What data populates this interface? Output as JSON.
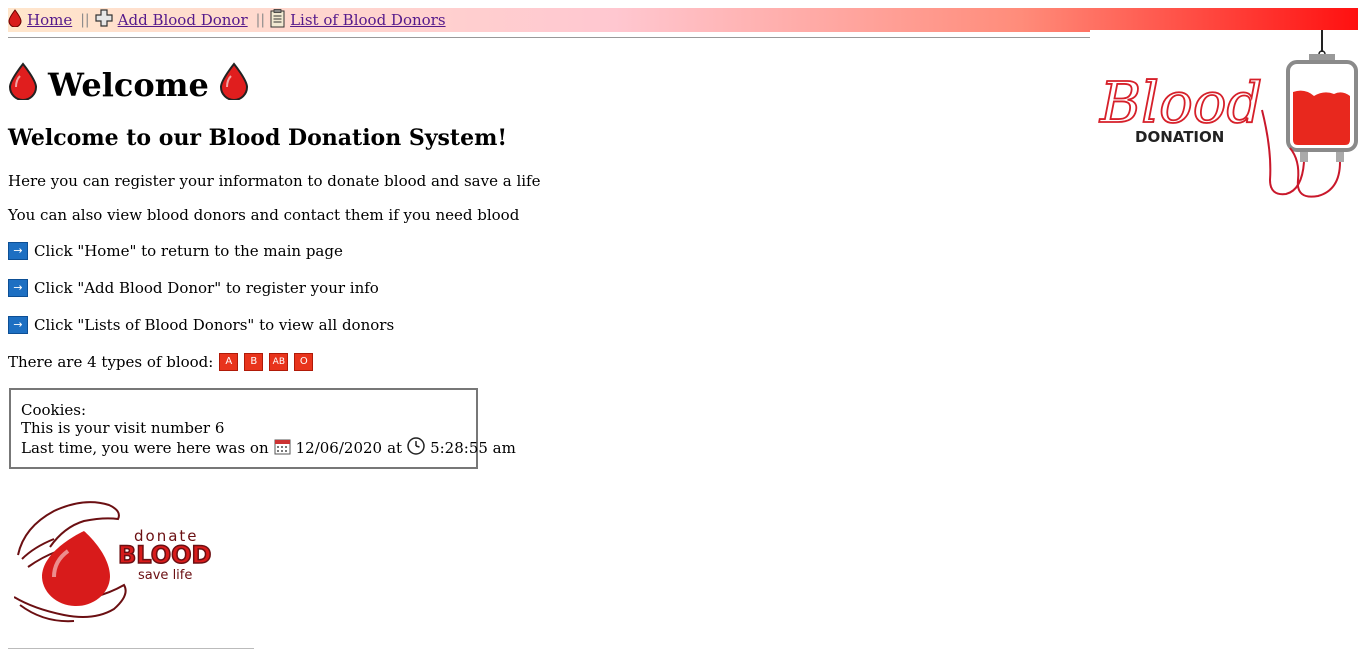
{
  "nav": {
    "home": "Home",
    "separator": "||",
    "add_donor": "Add Blood Donor",
    "list_donors": "List of Blood Donors",
    "icons": [
      "blood-drop-icon",
      "plus-icon",
      "clipboard-icon"
    ]
  },
  "page": {
    "heading": "Welcome",
    "subheading": "Welcome to our Blood Donation System!",
    "intro1": "Here you can register your informaton to donate blood and save a life",
    "intro2": "You can also view blood donors and contact them if you need blood",
    "instructions": [
      "Click \"Home\" to return to the main page",
      "Click \"Add Blood Donor\" to register your info",
      "Click \"Lists of Blood Donors\" to view all donors"
    ],
    "types_label": "There are 4 types of blood:",
    "blood_types": [
      "A",
      "B",
      "AB",
      "O"
    ]
  },
  "cookies": {
    "title": "Cookies:",
    "visit_line": "This is your visit number 6",
    "last_prefix": "Last time, you were here was on",
    "date": "12/06/2020",
    "at": "at",
    "time": "5:28:55 am"
  },
  "logos": {
    "top_word": "Blood",
    "top_sub": "DONATION",
    "bottom_line1": "donate",
    "bottom_line2": "BLOOD",
    "bottom_line3": "save life"
  },
  "colors": {
    "blood_red": "#e8281e",
    "link": "#551a8b",
    "arrow_blue": "#1d6fc2"
  }
}
